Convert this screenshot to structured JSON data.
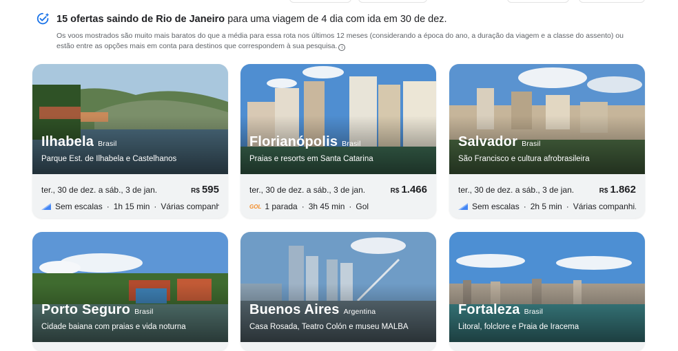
{
  "header": {
    "title_bold": "15 ofertas saindo de Rio de Janeiro",
    "title_rest": "para uma viagem de 4 dia com ida em 30 de dez.",
    "description": "Os voos mostrados são muito mais baratos do que a média para essa rota nos últimos 12 meses (considerando a época do ano, a duração da viagem e a classe do assento) ou estão entre as opções mais em conta para destinos que correspondem à sua pesquisa.",
    "icon": "check-sparkle-icon",
    "help_icon": "info-icon"
  },
  "cards": [
    {
      "city": "Ilhabela",
      "country": "Brasil",
      "subtitle": "Parque Est. de Ilhabela e Castelhanos",
      "dates": "ter., 30 de dez. a sáb., 3 de jan.",
      "currency": "R$",
      "price": "595",
      "stops": "Sem escalas",
      "duration": "1h 15 min",
      "airline": "Várias companhi...",
      "airline_icon": "multi-airline-icon"
    },
    {
      "city": "Florianópolis",
      "country": "Brasil",
      "subtitle": "Praias e resorts em Santa Catarina",
      "dates": "ter., 30 de dez. a sáb., 3 de jan.",
      "currency": "R$",
      "price": "1.466",
      "stops": "1 parada",
      "duration": "3h 45 min",
      "airline": "Gol",
      "airline_icon": "GOL"
    },
    {
      "city": "Salvador",
      "country": "Brasil",
      "subtitle": "São Francisco e cultura afrobrasileira",
      "dates": "ter., 30 de dez. a sáb., 3 de jan.",
      "currency": "R$",
      "price": "1.862",
      "stops": "Sem escalas",
      "duration": "2h 5 min",
      "airline": "Várias companhi...",
      "airline_icon": "multi-airline-icon"
    },
    {
      "city": "Porto Seguro",
      "country": "Brasil",
      "subtitle": "Cidade baiana com praias e vida noturna"
    },
    {
      "city": "Buenos Aires",
      "country": "Argentina",
      "subtitle": "Casa Rosada, Teatro Colón e museu MALBA"
    },
    {
      "city": "Fortaleza",
      "country": "Brasil",
      "subtitle": "Litoral, folclore e Praia de Iracema"
    }
  ],
  "sep": "·",
  "colors": {
    "accent": "#1a73e8",
    "text": "#202124",
    "muted": "#5f6368",
    "card_bg": "#f1f3f4"
  }
}
